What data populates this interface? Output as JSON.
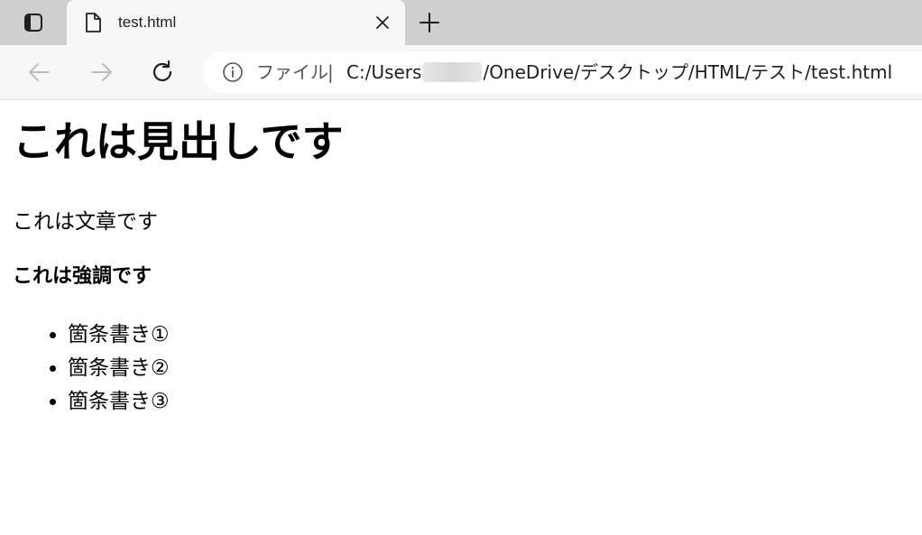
{
  "browser": {
    "tab": {
      "title": "test.html",
      "file_icon": "file-icon",
      "close_icon": "close-icon"
    },
    "new_tab_icon": "plus-icon",
    "tab_actions_icon": "tab-actions-icon",
    "nav": {
      "back_icon": "back-arrow-icon",
      "forward_icon": "forward-arrow-icon",
      "refresh_icon": "refresh-icon"
    },
    "address": {
      "info_icon": "info-icon",
      "file_label": "ファイル",
      "separator": "|",
      "url_prefix": "C:/Users",
      "url_suffix": "/OneDrive/デスクトップ/HTML/テスト/test.html"
    }
  },
  "page": {
    "heading": "これは見出しです",
    "paragraph": "これは文章です",
    "emphasis": "これは強調です",
    "list_items": [
      "箇条書き①",
      "箇条書き②",
      "箇条書き③"
    ]
  },
  "colors": {
    "tabstrip_bg": "#cfcfcf",
    "toolbar_bg": "#f7f7f7",
    "page_bg": "#ffffff"
  }
}
